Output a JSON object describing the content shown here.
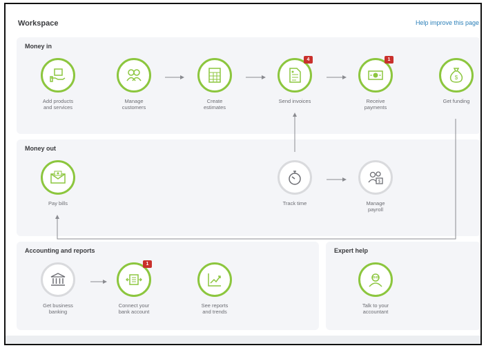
{
  "workspace": {
    "title": "Workspace",
    "help_link": "Help improve this page"
  },
  "money_in": {
    "title": "Money in",
    "nodes": [
      {
        "label": "Add products\nand services",
        "icon": "product-hand-icon"
      },
      {
        "label": "Manage\ncustomers",
        "icon": "customers-icon"
      },
      {
        "label": "Create\nestimates",
        "icon": "estimate-icon"
      },
      {
        "label": "Send invoices",
        "icon": "invoice-icon",
        "badge": "4"
      },
      {
        "label": "Receive\npayments",
        "icon": "payment-icon",
        "badge": "1"
      },
      {
        "label": "Get funding",
        "icon": "money-bag-icon"
      }
    ]
  },
  "money_out": {
    "title": "Money out",
    "nodes": [
      {
        "label": "Pay bills",
        "icon": "bill-envelope-icon"
      },
      {
        "label": "Track time",
        "icon": "stopwatch-icon"
      },
      {
        "label": "Manage\npayroll",
        "icon": "payroll-icon"
      }
    ]
  },
  "accounting": {
    "title": "Accounting and reports",
    "nodes": [
      {
        "label": "Get business\nbanking",
        "icon": "bank-icon"
      },
      {
        "label": "Connect your\nbank account",
        "icon": "bank-connect-icon",
        "badge": "1"
      },
      {
        "label": "See reports\nand trends",
        "icon": "chart-icon"
      }
    ]
  },
  "expert_help": {
    "title": "Expert help",
    "nodes": [
      {
        "label": "Talk to your\naccountant",
        "icon": "accountant-icon"
      }
    ]
  },
  "colors": {
    "accent_green": "#8cc63e",
    "badge_red": "#c9302c",
    "link_blue": "#2a7fb8",
    "panel_bg": "#f4f5f8"
  }
}
